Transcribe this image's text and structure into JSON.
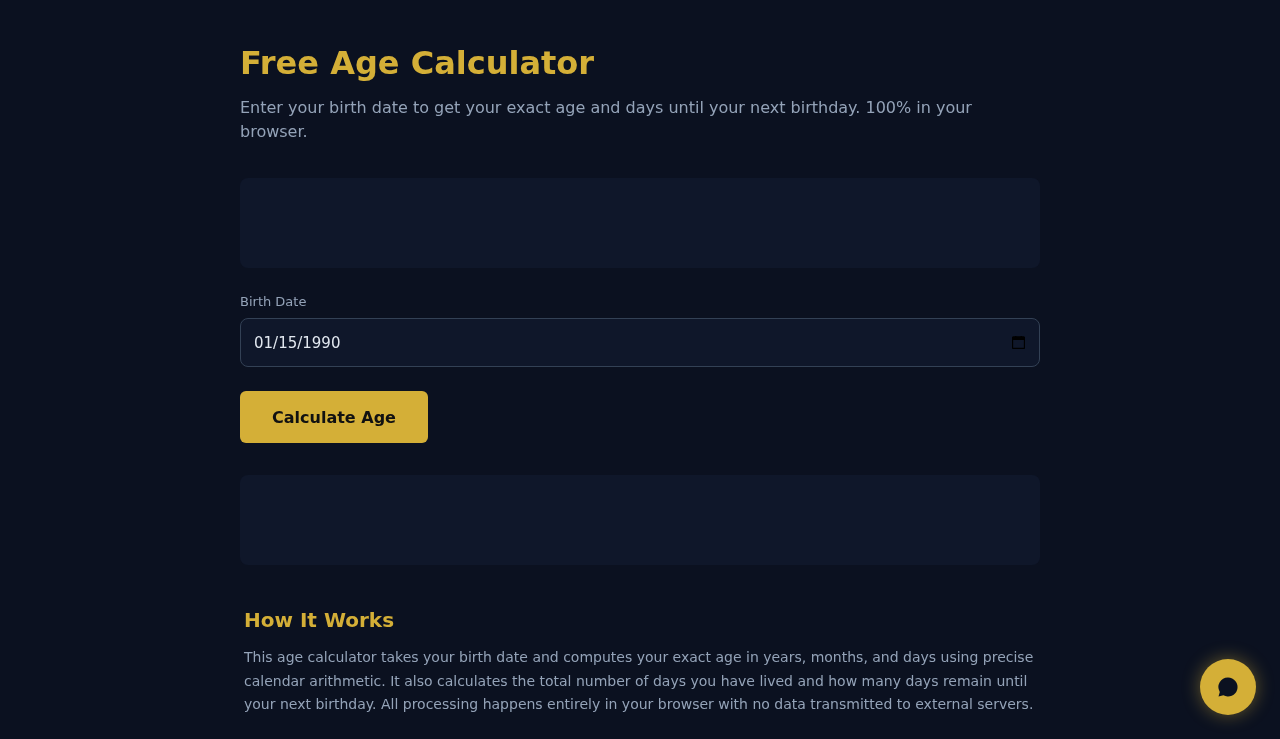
{
  "header": {
    "title": "Free Age Calculator",
    "subtitle": "Enter your birth date to get your exact age and days until your next birthday. 100% in your browser."
  },
  "form": {
    "label": "Birth Date",
    "value": "01/15/1990",
    "button": "Calculate Age"
  },
  "info": {
    "heading": "How It Works",
    "text": "This age calculator takes your birth date and computes your exact age in years, months, and days using precise calendar arithmetic. It also calculates the total number of days you have lived and how many days remain until your next birthday. All processing happens entirely in your browser with no data transmitted to external servers."
  }
}
